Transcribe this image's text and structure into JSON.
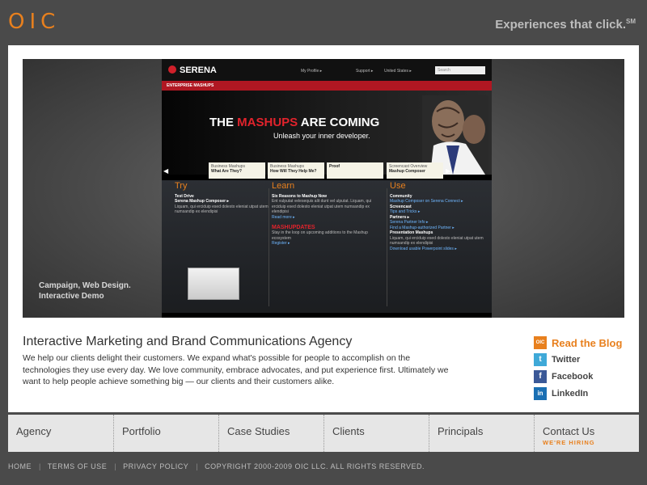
{
  "header": {
    "logo": "OIC",
    "tagline": "Experiences that click.",
    "tagline_mark": "SM"
  },
  "hero": {
    "caption_line1": "Campaign, Web Design.",
    "caption_line2": "Interactive Demo",
    "site": {
      "logo": "SERENA",
      "nav": [
        "My Profile ▸",
        "Support ▸",
        "United States ▸"
      ],
      "search_placeholder": "Search",
      "bar": "ENTERPRISE MASHUPS",
      "headline_pre": "THE ",
      "headline_red": "MASHUPS",
      "headline_post": " ARE COMING",
      "subhead": "Unleash your inner developer.",
      "tabs": [
        {
          "top": "Business Mashups",
          "bottom": "What Are They?"
        },
        {
          "top": "Business Mashups",
          "bottom": "How Will They Help Me?"
        },
        {
          "top": "",
          "bottom": "Proof"
        },
        {
          "top": "Screencast Overview",
          "bottom": "Mashup Composer"
        }
      ],
      "columns": [
        {
          "title": "Try",
          "lines": [
            "Test Drive",
            "Serena Mashup Composer ▸",
            "Liquam, qui erciduip esed dolesto eleniat utpat utem numsandip ex elendipisi"
          ]
        },
        {
          "title": "Learn",
          "lines": [
            "Six Reasons to Mashup Now",
            "Ent vulputat velesequis alit dunt vel ulputat. Liquam, qui erciduip esed dolesto eleniat utpat utem numsandip ex elendipisi",
            "Read more ▸",
            "MASHUPDATES",
            "Stay in the loop on upcoming additions to the Mashup ecosystem",
            "Register ▸"
          ]
        },
        {
          "title": "Use",
          "lines": [
            "Community",
            "Mashup Composer on Serena Connect ▸",
            "Screencast",
            "Tips and Tricks ▸",
            "Partners ▸",
            "Serena Partner Info ▸",
            "Find a Mashup-authorized Partner ▸",
            "Presentation Mashups",
            "Liquam, qui erciduip esed dolesto eleniat utpat utem numsandip ex elendipisi",
            "Download usable Powerpoint slides ▸"
          ]
        }
      ]
    }
  },
  "intro": {
    "title": "Interactive Marketing and Brand Communications Agency",
    "body": "We help our clients delight their customers. We expand what's possible for people to accomplish on the technologies they use every day. We love community, embrace advocates, and put experience first. Ultimately we want to help people achieve something big — our clients and their customers alike."
  },
  "social": [
    {
      "label": "Read the Blog",
      "icon": "oic-blog-icon",
      "color": "#e8801e"
    },
    {
      "label": "Twitter",
      "icon": "twitter-icon",
      "color": "#3fa9d8"
    },
    {
      "label": "Facebook",
      "icon": "facebook-icon",
      "color": "#3b5998"
    },
    {
      "label": "LinkedIn",
      "icon": "linkedin-icon",
      "color": "#1a6fb3"
    }
  ],
  "nav": [
    {
      "label": "Agency"
    },
    {
      "label": "Portfolio"
    },
    {
      "label": "Case Studies"
    },
    {
      "label": "Clients"
    },
    {
      "label": "Principals"
    },
    {
      "label": "Contact Us",
      "sub": "WE'RE HIRING"
    }
  ],
  "footer": [
    "HOME",
    "TERMS OF USE",
    "PRIVACY POLICY",
    "COPYRIGHT 2000-2009 OIC LLC. ALL RIGHTS RESERVED."
  ],
  "colors": {
    "accent": "#e8801e",
    "background": "#4a4a4a",
    "panel": "#ffffff",
    "serena_red": "#b01722"
  }
}
